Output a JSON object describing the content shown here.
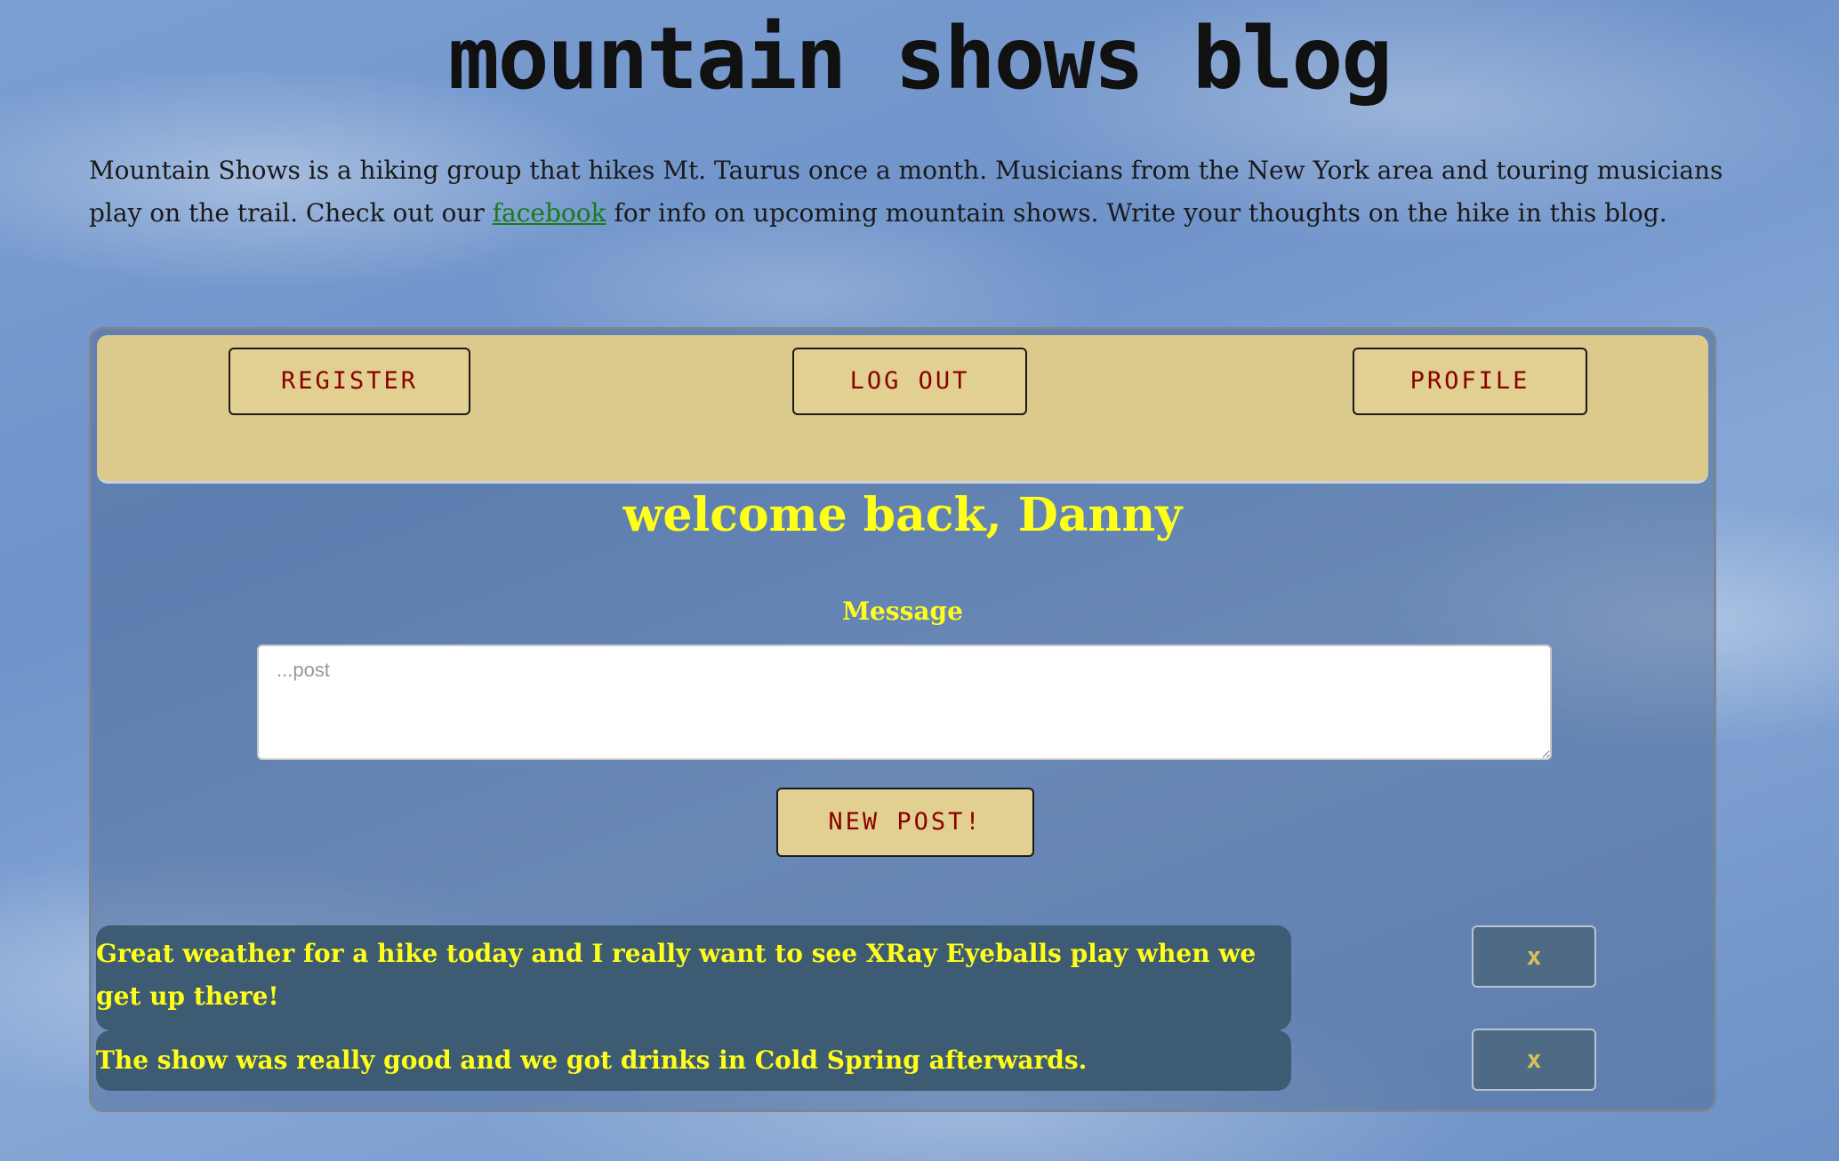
{
  "header": {
    "title": "mountain shows blog"
  },
  "intro": {
    "text_before_link": "Mountain Shows is a hiking group that hikes Mt. Taurus once a month. Musicians from the New York area and touring musicians play on the trail. Check out our ",
    "link_text": "facebook",
    "text_after_link": " for info on upcoming mountain shows. Write your thoughts on the hike in this blog."
  },
  "nav": {
    "register_label": "REGISTER",
    "logout_label": "LOG OUT",
    "profile_label": "PROFILE"
  },
  "main": {
    "welcome": "welcome back, Danny",
    "message_label": "Message",
    "post_placeholder": "...post",
    "new_post_label": "NEW POST!"
  },
  "posts": [
    {
      "text": "Great weather for a hike today and I really want to see XRay Eyeballs play when we get up there!",
      "delete_label": "x"
    },
    {
      "text": "The show was really good and we got drinks in Cold Spring afterwards.",
      "delete_label": "x"
    }
  ],
  "colors": {
    "nav_bg": "#dcc98c",
    "button_text": "#8a0000",
    "accent_yellow": "#ffff1a",
    "post_bg": "#3e5b74",
    "link_green": "#1a7a1a"
  }
}
